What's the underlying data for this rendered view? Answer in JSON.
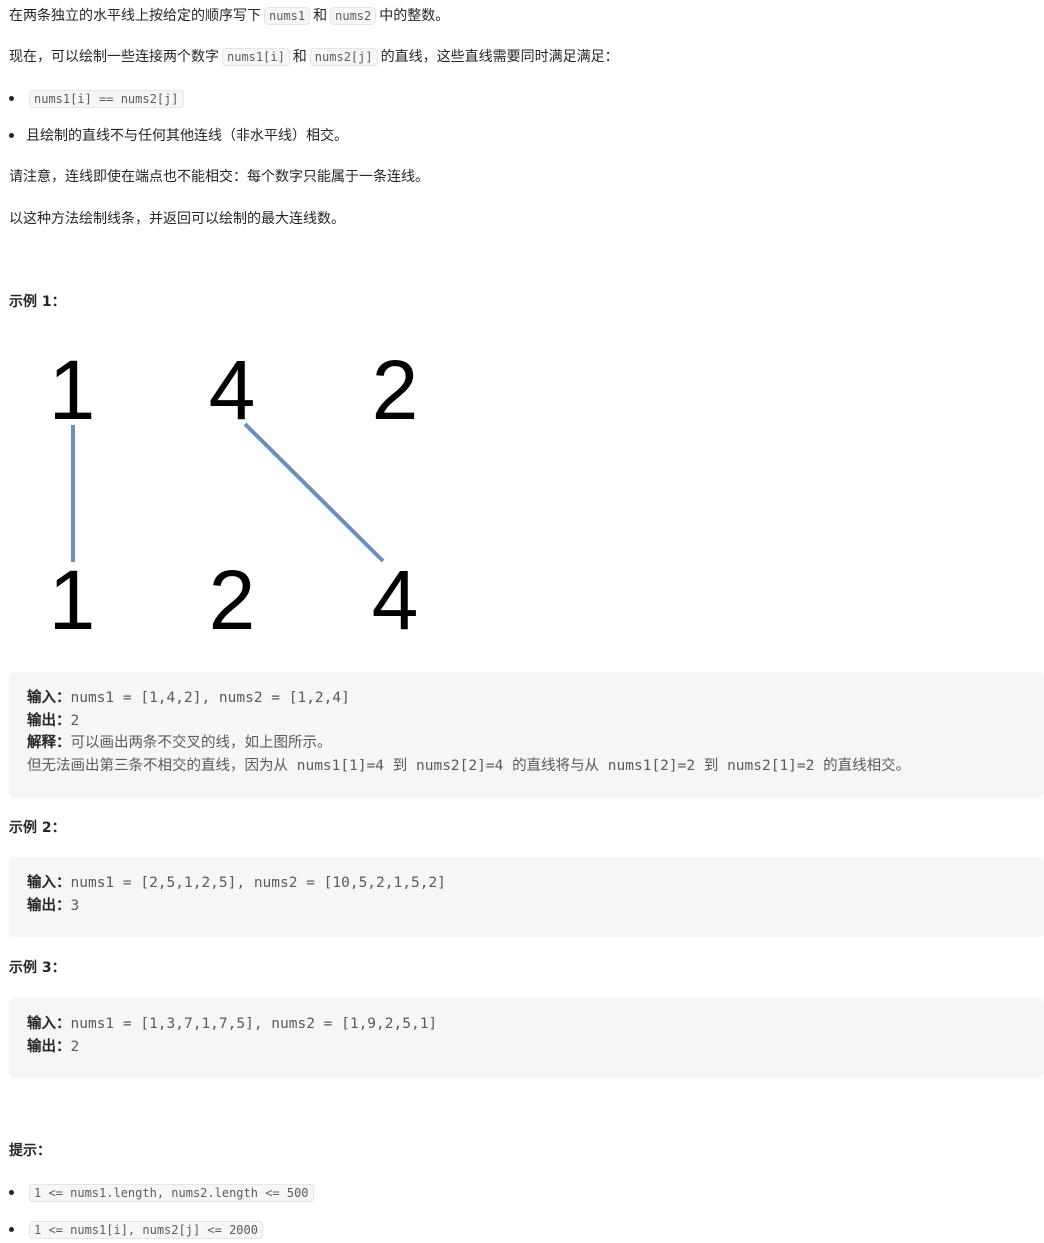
{
  "intro": {
    "p1_a": "在两条独立的水平线上按给定的顺序写下",
    "p1_code1": "nums1",
    "p1_b": "和",
    "p1_code2": "nums2",
    "p1_c": "中的整数。",
    "p2_a": "现在，可以绘制一些连接两个数字",
    "p2_code1": "nums1[i]",
    "p2_b": "和",
    "p2_code2": "nums2[j]",
    "p2_c": "的直线，这些直线需要同时满足满足：",
    "bullet1_code": "nums1[i] == nums2[j]",
    "bullet2": "且绘制的直线不与任何其他连线（非水平线）相交。",
    "p3": "请注意，连线即使在端点也不能相交：每个数字只能属于一条连线。",
    "p4": "以这种方法绘制线条，并返回可以绘制的最大连线数。"
  },
  "example1": {
    "heading": "示例 1：",
    "figure": {
      "top": [
        "1",
        "4",
        "2"
      ],
      "bottom": [
        "1",
        "2",
        "4"
      ],
      "line_color": "#6c8ebf"
    },
    "input_label": "输入：",
    "input_value": "nums1 = [1,4,2], nums2 = [1,2,4]",
    "output_label": "输出：",
    "output_value": "2",
    "explain_label": "解释：",
    "explain_line1": "可以画出两条不交叉的线，如上图所示。",
    "explain_line2_a": "但无法画出第三条不相交的直线，因为从",
    "explain_line2_code1": "nums1[1]=4",
    "explain_line2_b": "到",
    "explain_line2_code2": "nums2[2]=4",
    "explain_line2_c": "的直线将与从",
    "explain_line2_code3": "nums1[2]=2",
    "explain_line2_d": "到",
    "explain_line2_code4": "nums2[1]=2",
    "explain_line2_e": "的直线相交。"
  },
  "example2": {
    "heading": "示例 2：",
    "input_label": "输入：",
    "input_value": "nums1 = [2,5,1,2,5], nums2 = [10,5,2,1,5,2]",
    "output_label": "输出：",
    "output_value": "3"
  },
  "example3": {
    "heading": "示例 3：",
    "input_label": "输入：",
    "input_value": "nums1 = [1,3,7,1,7,5], nums2 = [1,9,2,5,1]",
    "output_label": "输出：",
    "output_value": "2"
  },
  "hints": {
    "heading": "提示：",
    "items": [
      "1 <= nums1.length, nums2.length <= 500",
      "1 <= nums1[i], nums2[j] <= 2000"
    ]
  }
}
